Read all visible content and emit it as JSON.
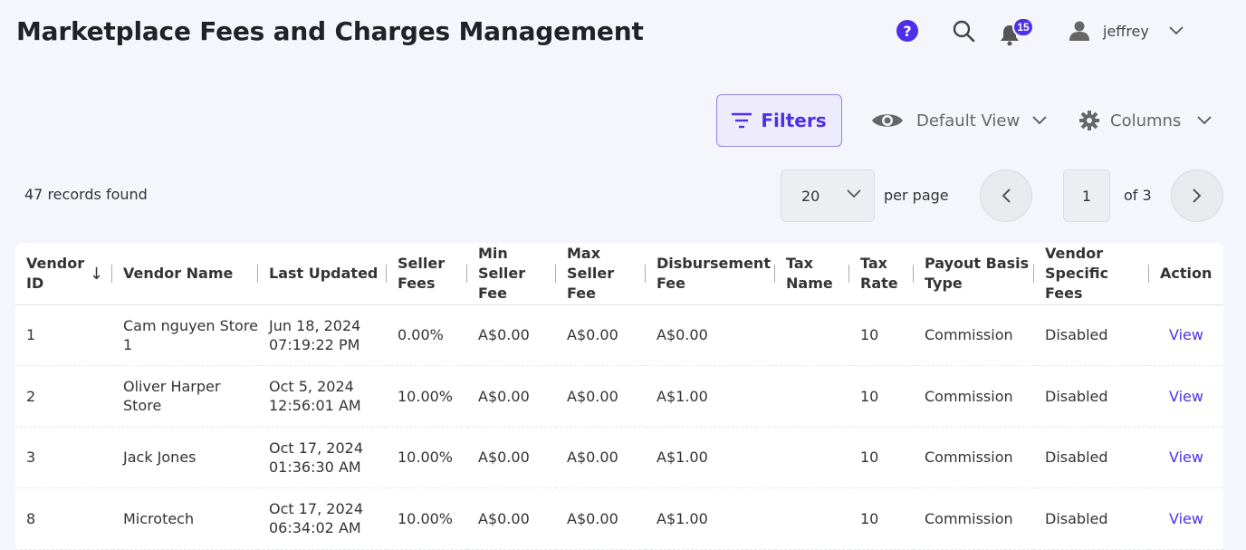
{
  "header": {
    "title": "Marketplace Fees and Charges Management",
    "help_glyph": "?",
    "notifications_count": "15",
    "username": "jeffrey"
  },
  "toolbar": {
    "filters_label": "Filters",
    "view_label": "Default View",
    "columns_label": "Columns"
  },
  "pagination": {
    "records_text": "47 records found",
    "per_page_value": "20",
    "per_page_label": "per page",
    "current_page": "1",
    "of_text": "of 3"
  },
  "table": {
    "headers": {
      "vendor_id": [
        "Vendor",
        "ID"
      ],
      "vendor_name": "Vendor Name",
      "last_updated": "Last Updated",
      "seller_fees": [
        "Seller",
        "Fees"
      ],
      "min_seller_fee": [
        "Min",
        "Seller Fee"
      ],
      "max_seller_fee": [
        "Max",
        "Seller Fee"
      ],
      "disbursement_fee": [
        "Disbursement",
        "Fee"
      ],
      "tax_name": [
        "Tax",
        "Name"
      ],
      "tax_rate": [
        "Tax",
        "Rate"
      ],
      "payout_basis_type": [
        "Payout Basis",
        "Type"
      ],
      "vendor_specific_fees": [
        "Vendor",
        "Specific Fees"
      ],
      "action": "Action"
    },
    "sort_glyph": "↓",
    "rows": [
      {
        "vendor_id": "1",
        "vendor_name": [
          "Cam nguyen Store",
          "1"
        ],
        "last_updated": [
          "Jun 18, 2024",
          "07:19:22 PM"
        ],
        "seller_fees": "0.00%",
        "min_seller_fee": "A$0.00",
        "max_seller_fee": "A$0.00",
        "disbursement_fee": "A$0.00",
        "tax_name": "",
        "tax_rate": "10",
        "payout_basis_type": "Commission",
        "vendor_specific_fees": "Disabled",
        "action": "View"
      },
      {
        "vendor_id": "2",
        "vendor_name": [
          "Oliver Harper",
          "Store"
        ],
        "last_updated": [
          "Oct 5, 2024",
          "12:56:01 AM"
        ],
        "seller_fees": "10.00%",
        "min_seller_fee": "A$0.00",
        "max_seller_fee": "A$0.00",
        "disbursement_fee": "A$1.00",
        "tax_name": "",
        "tax_rate": "10",
        "payout_basis_type": "Commission",
        "vendor_specific_fees": "Disabled",
        "action": "View"
      },
      {
        "vendor_id": "3",
        "vendor_name": [
          "Jack Jones",
          ""
        ],
        "last_updated": [
          "Oct 17, 2024",
          "01:36:30 AM"
        ],
        "seller_fees": "10.00%",
        "min_seller_fee": "A$0.00",
        "max_seller_fee": "A$0.00",
        "disbursement_fee": "A$1.00",
        "tax_name": "",
        "tax_rate": "10",
        "payout_basis_type": "Commission",
        "vendor_specific_fees": "Disabled",
        "action": "View"
      },
      {
        "vendor_id": "8",
        "vendor_name": [
          "Microtech",
          ""
        ],
        "last_updated": [
          "Oct 17, 2024",
          "06:34:02 AM"
        ],
        "seller_fees": "10.00%",
        "min_seller_fee": "A$0.00",
        "max_seller_fee": "A$0.00",
        "disbursement_fee": "A$1.00",
        "tax_name": "",
        "tax_rate": "10",
        "payout_basis_type": "Commission",
        "vendor_specific_fees": "Disabled",
        "action": "View"
      }
    ]
  },
  "colors": {
    "accent": "#4f2ee8",
    "background": "#f4f6fb"
  },
  "icons": {
    "help": "help-circle-icon",
    "search": "search-icon",
    "notifications": "bell-icon",
    "user": "user-icon",
    "filter": "filter-icon",
    "view": "eye-icon",
    "columns": "gear-icon"
  }
}
